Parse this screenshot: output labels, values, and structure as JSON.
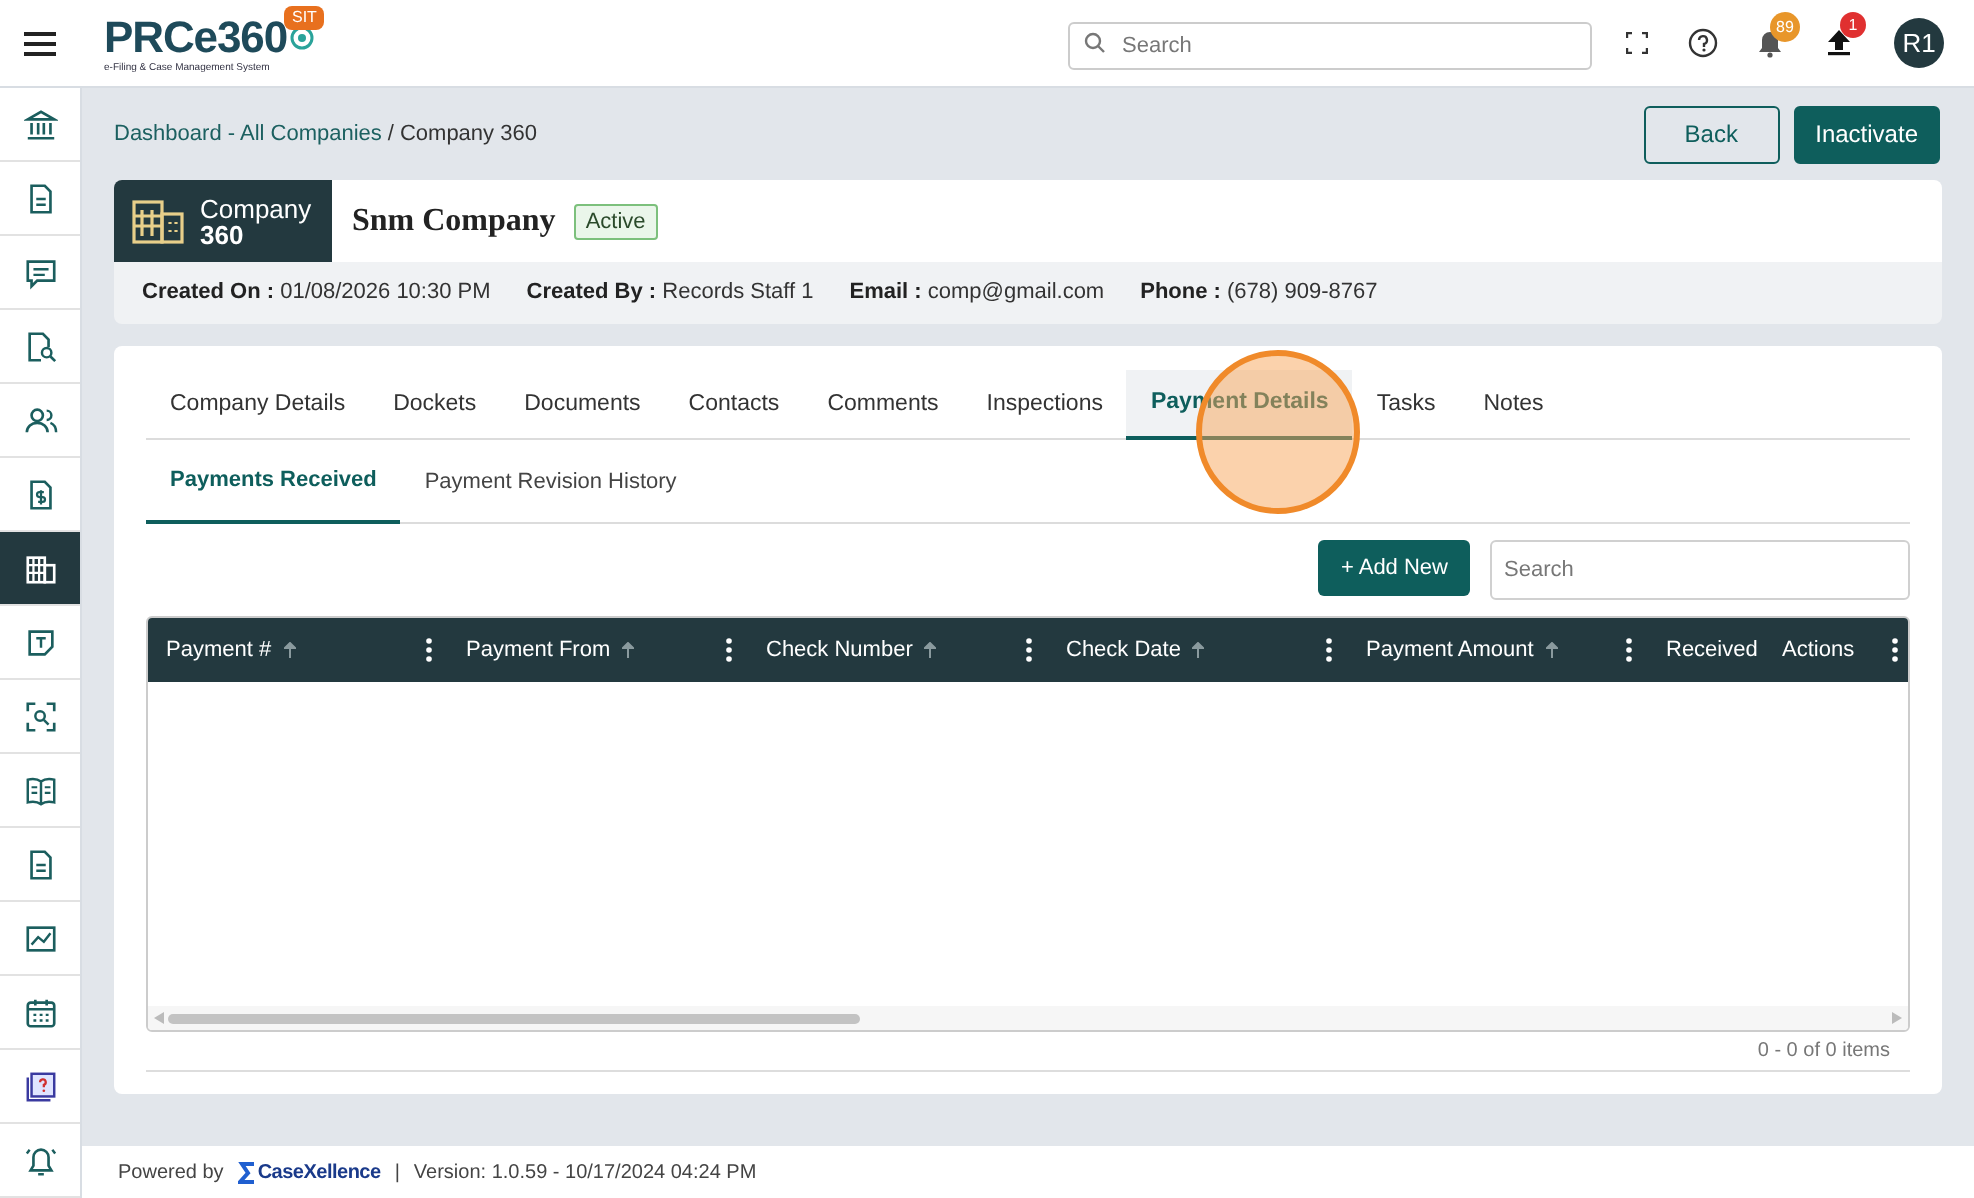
{
  "header": {
    "logo_name": "PRCe360",
    "logo_tagline": "e-Filing & Case Management System",
    "env_badge": "SIT",
    "search": {
      "placeholder": "Search"
    },
    "notification_count": "89",
    "upload_count": "1",
    "avatar": "R1"
  },
  "sidebar": {
    "items": [
      {
        "kind": "bank",
        "selected": false
      },
      {
        "kind": "document",
        "selected": false
      },
      {
        "kind": "chat",
        "selected": false
      },
      {
        "kind": "doc-search",
        "selected": false
      },
      {
        "kind": "users",
        "selected": false
      },
      {
        "kind": "doc-dollar",
        "selected": false
      },
      {
        "kind": "building",
        "selected": true
      },
      {
        "kind": "note",
        "selected": false
      },
      {
        "kind": "scan",
        "selected": false
      },
      {
        "kind": "book",
        "selected": false
      },
      {
        "kind": "document",
        "selected": false
      },
      {
        "kind": "chart",
        "selected": false
      },
      {
        "kind": "calendar",
        "selected": false
      },
      {
        "kind": "help-book",
        "selected": false
      },
      {
        "kind": "alarm",
        "selected": false
      }
    ]
  },
  "breadcrumb": {
    "link": "Dashboard - All Companies",
    "separator": "/",
    "current": "Company 360"
  },
  "actions": [
    {
      "label": "Back",
      "kind": "outline"
    },
    {
      "label": "Inactivate",
      "kind": "primary"
    }
  ],
  "company": {
    "badge_label": "Company",
    "badge_number": "360",
    "name": "Snm Company",
    "status": "Active",
    "details": [
      {
        "label": "Created On :",
        "value": "01/08/2026 10:30 PM"
      },
      {
        "label": "Created By :",
        "value": "Records Staff 1"
      },
      {
        "label": "Email :",
        "value": "comp@gmail.com"
      },
      {
        "label": "Phone :",
        "value": "(678) 909-8767"
      }
    ]
  },
  "tabs": [
    {
      "label": "Company Details",
      "selected": false
    },
    {
      "label": "Dockets",
      "selected": false
    },
    {
      "label": "Documents",
      "selected": false
    },
    {
      "label": "Contacts",
      "selected": false
    },
    {
      "label": "Comments",
      "selected": false
    },
    {
      "label": "Inspections",
      "selected": false
    },
    {
      "label": "Payment Details",
      "selected": true
    },
    {
      "label": "Tasks",
      "selected": false
    },
    {
      "label": "Notes",
      "selected": false
    }
  ],
  "subtabs": [
    {
      "label": "Payments Received",
      "selected": true
    },
    {
      "label": "Payment Revision History",
      "selected": false
    }
  ],
  "add_button": "+ Add New",
  "table_search": {
    "placeholder": "Search"
  },
  "table": {
    "columns": [
      {
        "label": "Payment #",
        "sortable": true,
        "menu": true
      },
      {
        "label": "Payment From",
        "sortable": true,
        "menu": true
      },
      {
        "label": "Check Number",
        "sortable": true,
        "menu": true
      },
      {
        "label": "Check Date",
        "sortable": true,
        "menu": true
      },
      {
        "label": "Payment Amount",
        "sortable": true,
        "menu": true
      },
      {
        "label": "Received",
        "sortable": false,
        "menu": false
      },
      {
        "label": "Actions",
        "sortable": false,
        "menu": true
      }
    ],
    "pager": "0 - 0 of 0 items"
  },
  "footer": {
    "powered_by": "Powered by",
    "brand": "CaseXellence",
    "separator": "|",
    "version": "Version: 1.0.59 - 10/17/2024 04:24 PM"
  }
}
